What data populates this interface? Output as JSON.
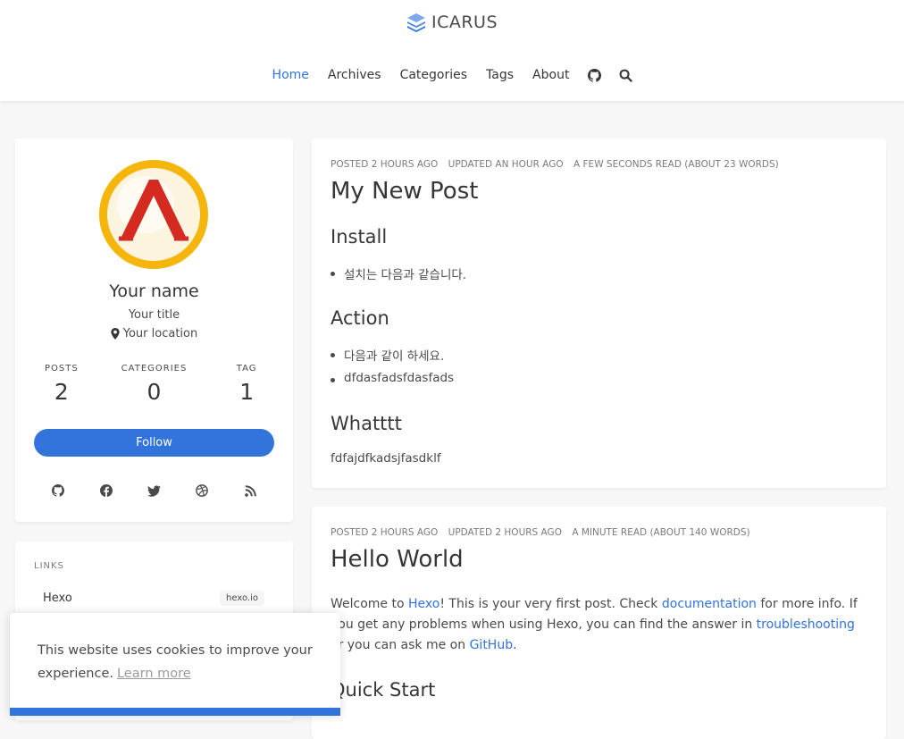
{
  "brand": {
    "name": "ICARUS"
  },
  "nav": {
    "items": [
      {
        "label": "Home",
        "active": true
      },
      {
        "label": "Archives"
      },
      {
        "label": "Categories"
      },
      {
        "label": "Tags"
      },
      {
        "label": "About"
      }
    ],
    "icons": [
      "github-icon",
      "search-icon"
    ]
  },
  "profile": {
    "name": "Your name",
    "title": "Your title",
    "location": "Your location",
    "stats": [
      {
        "label": "POSTS",
        "value": "2"
      },
      {
        "label": "CATEGORIES",
        "value": "0"
      },
      {
        "label": "TAG",
        "value": "1"
      }
    ],
    "follow_label": "Follow",
    "socials": [
      "github-icon",
      "facebook-icon",
      "twitter-icon",
      "dribbble-icon",
      "rss-icon"
    ]
  },
  "links": {
    "label": "LINKS",
    "items": [
      {
        "name": "Hexo",
        "url": "hexo.io"
      }
    ]
  },
  "post1": {
    "meta": [
      "POSTED 2 HOURS AGO",
      "UPDATED AN HOUR AGO",
      "A FEW SECONDS READ (ABOUT 23 WORDS)"
    ],
    "title": "My New Post",
    "h_install": "Install",
    "install_items": [
      "설치는 다음과 같습니다."
    ],
    "h_action": "Action",
    "action_items": [
      "다음과 같이 하세요.",
      "dfdasfadsfdasfads"
    ],
    "h_whatttt": "Whatttt",
    "text": "fdfajdfkadsjfasdklf"
  },
  "post2": {
    "meta": [
      "POSTED 2 HOURS AGO",
      "UPDATED 2 HOURS AGO",
      "A MINUTE READ (ABOUT 140 WORDS)"
    ],
    "title": "Hello World",
    "p1": "Welcome to ",
    "hexo_link": "Hexo",
    "p2": "! This is your very first post. Check ",
    "doc_link": "documentation",
    "p3": " for more info. If you get any problems when using Hexo, you can find the answer in ",
    "trouble_link": "troubleshooting",
    "p4": " or you can ask me on ",
    "github_link": "GitHub",
    "p5": ".",
    "h_quick": "Quick Start"
  },
  "cookie": {
    "text": "This website uses cookies to improve your experience.",
    "learn_more": "Learn more"
  },
  "colors": {
    "accent": "#3273dc",
    "avatar_ring": "#f5b50a",
    "avatar_logo": "#cc1f1f"
  }
}
